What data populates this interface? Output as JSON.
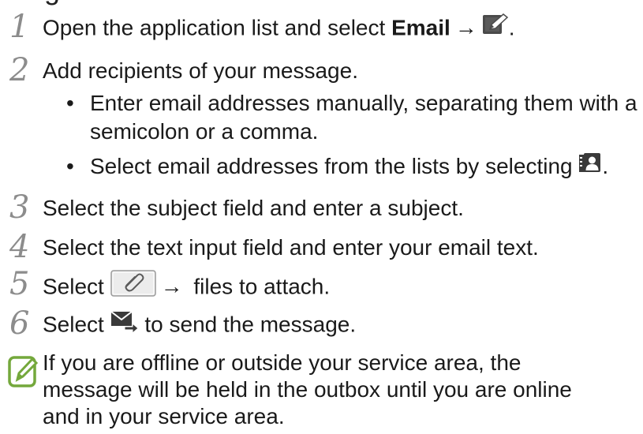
{
  "header": {
    "title_fragment": "g"
  },
  "steps": [
    {
      "num": "1",
      "text_before": "Open the application list and select ",
      "bold": "Email",
      "arrow": "→",
      "after": "."
    },
    {
      "num": "2",
      "text": "Add recipients of your message.",
      "bullets": [
        {
          "dot": "•",
          "line1": "Enter email addresses manually, separating them with a",
          "line2": "semicolon or a comma."
        },
        {
          "dot": "•",
          "text_before": "Select email addresses from the lists by selecting ",
          "after": "."
        }
      ]
    },
    {
      "num": "3",
      "text": "Select the subject field and enter a subject."
    },
    {
      "num": "4",
      "text": "Select the text input field and enter your email text."
    },
    {
      "num": "5",
      "text_before": "Select ",
      "arrow": "→",
      "after": " files to attach."
    },
    {
      "num": "6",
      "text_before": "Select ",
      "after": " to send the message."
    }
  ],
  "note": {
    "line1": "If you are offline or outside your service area, the",
    "line2": "message will be held in the outbox until you are online",
    "line3": "and in your service area."
  },
  "icons": {
    "compose": "compose-icon",
    "contacts": "contacts-icon",
    "attach": "paperclip-icon",
    "send": "send-icon",
    "note": "note-icon"
  },
  "colors": {
    "step_number": "#8c8c8c",
    "note_icon": "#74a83c",
    "text": "#1a1a1a"
  }
}
